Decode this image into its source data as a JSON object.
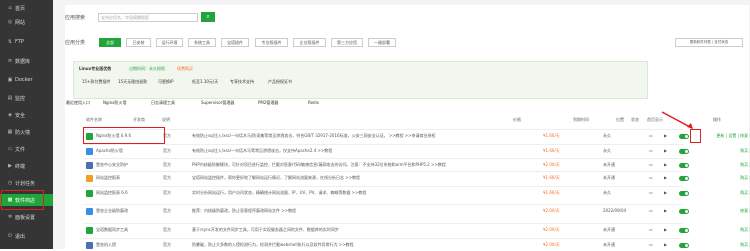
{
  "sidebar": {
    "items": [
      {
        "label": "首页",
        "icon": "home-icon"
      },
      {
        "label": "网站",
        "icon": "globe-icon"
      },
      {
        "label": "FTP",
        "icon": "ftp-icon"
      },
      {
        "label": "数据库",
        "icon": "database-icon"
      },
      {
        "label": "Docker",
        "icon": "docker-icon"
      },
      {
        "label": "监控",
        "icon": "monitor-icon"
      },
      {
        "label": "安全",
        "icon": "shield-icon"
      },
      {
        "label": "防火墙",
        "icon": "firewall-icon"
      },
      {
        "label": "文件",
        "icon": "folder-icon"
      },
      {
        "label": "终端",
        "icon": "terminal-icon"
      },
      {
        "label": "计划任务",
        "icon": "clock-icon"
      },
      {
        "label": "软件商店",
        "icon": "store-icon"
      },
      {
        "label": "面板设置",
        "icon": "gear-icon"
      },
      {
        "label": "退出",
        "icon": "logout-icon"
      }
    ]
  },
  "search": {
    "label": "应用搜索",
    "placeholder": "支持应用名、字段模糊搜索"
  },
  "categories": {
    "label": "应用分类",
    "items": [
      "全部",
      "已安装",
      "运行环境",
      "系统工具",
      "宝塔插件",
      "专业版插件",
      "企业版插件",
      "第三方应用",
      "一键部署"
    ],
    "right_link": "更新软件列表 / 支付状态"
  },
  "pro": {
    "title": "Linux专业版优势",
    "expire": "过期时间：永久授权",
    "renew": "续费购买",
    "features": [
      "15+款付费插件",
      "15天无理由退款",
      "可更换IP",
      "低至1.10元/天",
      "专享技术支持",
      "产品授权证书"
    ]
  },
  "quick": {
    "label": "最近使用入口",
    "items": [
      "Nginx防火墙",
      "日志清理工具",
      "Supervisor管理器",
      "PM2管理器",
      "Redis"
    ]
  },
  "table": {
    "headers": [
      "软件名称",
      "开发商",
      "说明",
      "价格",
      "到期时间",
      "位置",
      "状态",
      "首页显示",
      "操作"
    ],
    "rows": [
      {
        "name": "Nginx防火墙 6.9.6",
        "dev": "官方",
        "desc": "有效防止sql注入/xss/一句话木马/防采集等常见渗透攻击，符合GB/T 32917-2016标准，公安三网安全认证。 >>教程 >>申请商业授权",
        "price": "¥1.66/天",
        "expire": "永久",
        "ops": "更新 | 设置 | 修复 | 卸载",
        "color": "#20a53a"
      },
      {
        "name": "Apache防火墙",
        "dev": "官方",
        "desc": "有效防止sql注入/xss/一句话木马等常见渗透攻击，仅支持Apache2.4 >>教程",
        "price": "¥1.66/天",
        "expire": "永久",
        "ops": "购买 | 安装",
        "color": "#3a8ee6"
      },
      {
        "name": "堡垒中心安全防护",
        "dev": "官方",
        "desc": "PHP内核级防御模块，可针对项目进行监控，拦截对恶意代码/敏感信息/漏洞攻击的访问。注意：不支持32位系统和arm平台和PHP5.2 >>教程",
        "price": "¥2.00/天",
        "expire": "未开通",
        "ops": "购买 | 安装",
        "color": "#4a6fb5"
      },
      {
        "name": "网站监控报表",
        "dev": "官方",
        "desc": "宝塔网站监控插件，帮你更好地了解网站运行情况，了解网站流量来源，在线分析日志 >>教程",
        "price": "¥1.66/天",
        "expire": "未开通",
        "ops": "购买 | 安装",
        "color": "#f0a020"
      },
      {
        "name": "网站监控报表 6.6",
        "dev": "官方",
        "desc": "实时分析网站运行，用户访问状态，精确统计网站流量、IP、UV、PV、请求、蜘蛛等数据 >>教程",
        "price": "¥1.66/天",
        "expire": "永久",
        "ops": "购买 | 安装",
        "color": "#20a53a"
      },
      {
        "name": "堡垒企业级防篡改",
        "dev": "官方",
        "desc": "推荐：内核级防篡改，防止恶意程序篡改网站文件 >>教程",
        "price": "¥2.00/天",
        "expire": "2022/09/04",
        "ops": "修复 | 卸载",
        "color": "#3a8ee6"
      },
      {
        "name": "宝塔数据同步工具",
        "dev": "官方",
        "desc": "基于rsync开发的文件同步工具，可用于实现服务器之间的文件、数据库的实时同步",
        "price": "¥2.00/天",
        "expire": "未开通",
        "ops": "购买 | 安装",
        "color": "#20a53a"
      },
      {
        "name": "堡垒机入侵",
        "dev": "官方",
        "desc": "防暴破，防止大多数的入侵检测行为，检测并拦截webshell执行以及软件异常行为 >>教程",
        "price": "¥2.00/天",
        "expire": "未开通",
        "ops": "购买 | 安装",
        "color": "#4a6fb5"
      }
    ]
  }
}
